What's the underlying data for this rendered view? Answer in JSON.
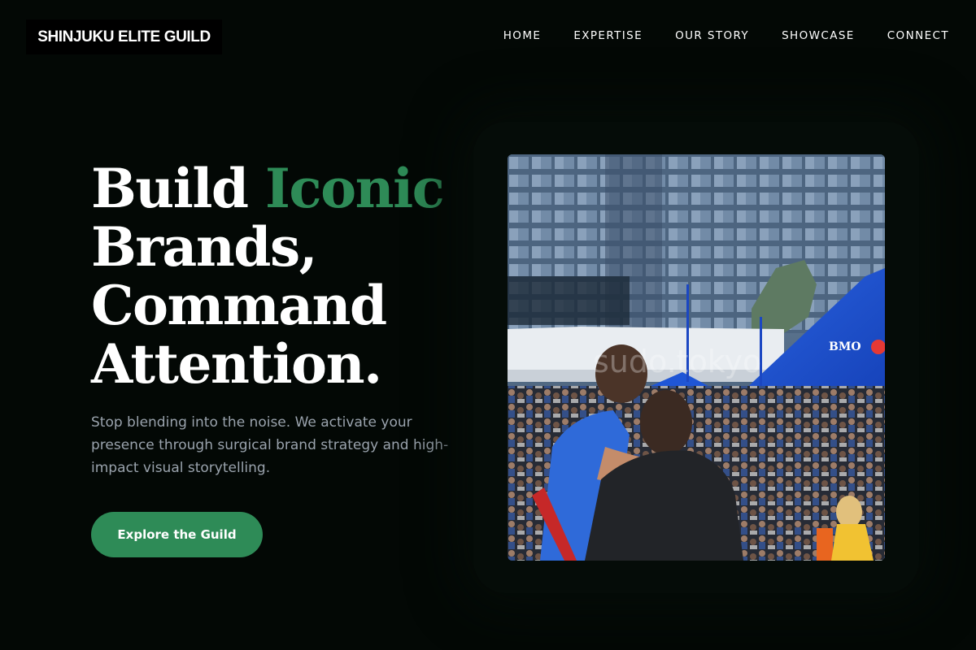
{
  "header": {
    "logo": "SHINJUKU ELITE GUILD",
    "nav": [
      "HOME",
      "EXPERTISE",
      "OUR STORY",
      "SHOWCASE",
      "CONNECT"
    ]
  },
  "hero": {
    "headline": {
      "word1": "Build",
      "accent_word": "Iconic",
      "line2": "Brands,",
      "line3": "Command",
      "line4": "Attention."
    },
    "subtext": "Stop blending into the noise. We activate your presence through surgical brand strategy and high-impact visual storytelling.",
    "cta_label": "Explore the Guild",
    "image": {
      "tent_sign": "BMO",
      "watermark": "sudo.tokyo"
    }
  },
  "colors": {
    "background": "#030805",
    "accent": "#2e8b57",
    "body_text": "#9aa3ad"
  }
}
